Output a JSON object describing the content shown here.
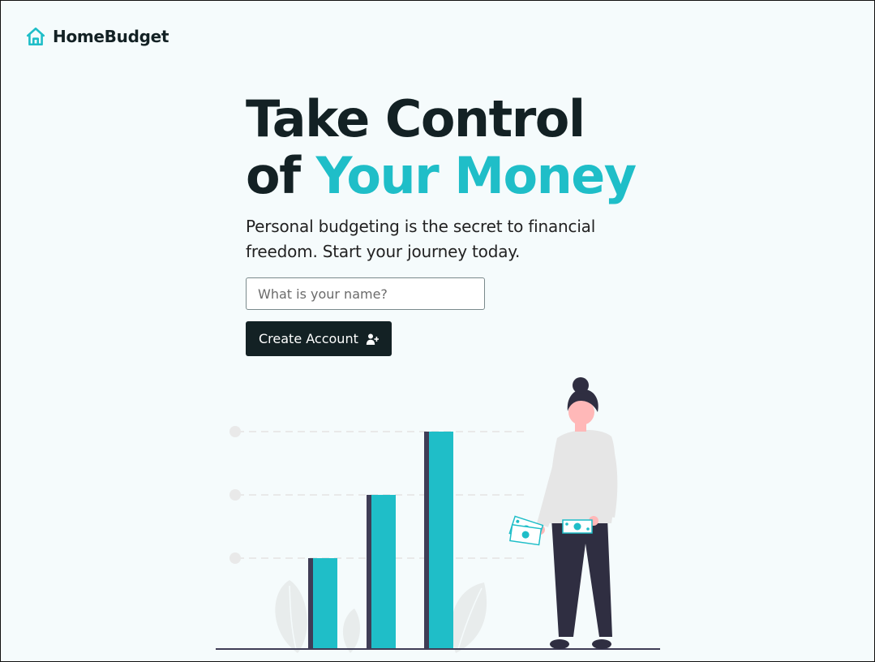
{
  "brand": {
    "name": "HomeBudget",
    "icon": "house-icon",
    "color": "#1fbec8"
  },
  "hero": {
    "title_line1": "Take Control",
    "title_of": "of",
    "title_accent": "Your Money",
    "subtitle": "Personal budgeting is the secret to financial freedom. Start your journey today."
  },
  "form": {
    "name_placeholder": "What is your name?",
    "name_value": "",
    "submit_label": "Create Account",
    "submit_icon": "user-plus-icon"
  },
  "colors": {
    "accent": "#1fbec8",
    "dark": "#132124",
    "background": "#f5fbfc"
  },
  "illustration": {
    "description_icon": "woman-with-bar-chart-illustration",
    "bar_levels": [
      1,
      2,
      3
    ]
  }
}
